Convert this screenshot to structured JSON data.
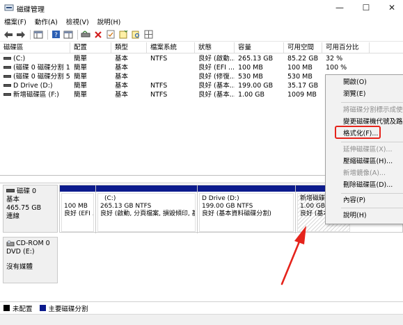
{
  "window": {
    "title": "磁碟管理",
    "minimize": "—",
    "maximize": "☐",
    "close": "✕"
  },
  "menu": [
    "檔案(F)",
    "動作(A)",
    "檢視(V)",
    "說明(H)"
  ],
  "columns": [
    "磁碟區",
    "配置",
    "類型",
    "檔案系統",
    "狀態",
    "容量",
    "可用空間",
    "可用百分比"
  ],
  "rows": [
    {
      "volume": "(C:)",
      "layout": "簡單",
      "type": "基本",
      "fs": "NTFS",
      "status": "良好 (啟動...",
      "capacity": "265.13 GB",
      "free": "85.22 GB",
      "pct": "32 %"
    },
    {
      "volume": "(磁碟 0 磁碟分割 1)",
      "layout": "簡單",
      "type": "基本",
      "fs": "",
      "status": "良好 (EFI ...",
      "capacity": "100 MB",
      "free": "100 MB",
      "pct": "100 %"
    },
    {
      "volume": "(磁碟 0 磁碟分割 5)",
      "layout": "簡單",
      "type": "基本",
      "fs": "",
      "status": "良好 (修復...",
      "capacity": "530 MB",
      "free": "530 MB",
      "pct": ""
    },
    {
      "volume": "D Drive (D:)",
      "layout": "簡單",
      "type": "基本",
      "fs": "NTFS",
      "status": "良好 (基本...",
      "capacity": "199.00 GB",
      "free": "35.17 GB",
      "pct": ""
    },
    {
      "volume": "新增磁碟區 (F:)",
      "layout": "簡單",
      "type": "基本",
      "fs": "NTFS",
      "status": "良好 (基本...",
      "capacity": "1.00 GB",
      "free": "1009 MB",
      "pct": ""
    }
  ],
  "disk0": {
    "name": "磁碟 0",
    "type": "基本",
    "size": "465.75 GB",
    "state": "連線",
    "partitions": [
      {
        "title": "",
        "line1": "100 MB",
        "line2": "良好 (EFI ..."
      },
      {
        "title": "(C:)",
        "line1": "265.13 GB NTFS",
        "line2": "良好 (啟動, 分頁檔案, 損毀傾印, 基"
      },
      {
        "title": "D Drive  (D:)",
        "line1": "199.00 GB NTFS",
        "line2": "良好 (基本資料磁碟分割)"
      },
      {
        "title": "新增磁碟",
        "line1": "1.00 GB I",
        "line2": "良好 (基本"
      }
    ]
  },
  "cdrom": {
    "name": "CD-ROM 0",
    "drive": "DVD (E:)",
    "media": "沒有媒體"
  },
  "legend": [
    {
      "label": "未配置",
      "color": "#000000"
    },
    {
      "label": "主要磁碟分割",
      "color": "#0c1b8d"
    }
  ],
  "context_menu": {
    "open": "開啟(O)",
    "explore": "瀏覽(E)",
    "mark_active": "將磁碟分割標示成使用中",
    "change_letter": "變更磁碟機代號及路徑",
    "format": "格式化(F)...",
    "extend": "延伸磁碟區(X)...",
    "shrink": "壓縮磁碟區(H)...",
    "mirror": "新增鏡像(A)...",
    "delete": "刪除磁碟區(D)...",
    "properties": "內容(P)",
    "help": "說明(H)"
  },
  "colors": {
    "partition_bar": "#0c1b8d",
    "highlight": "#e5231b"
  }
}
